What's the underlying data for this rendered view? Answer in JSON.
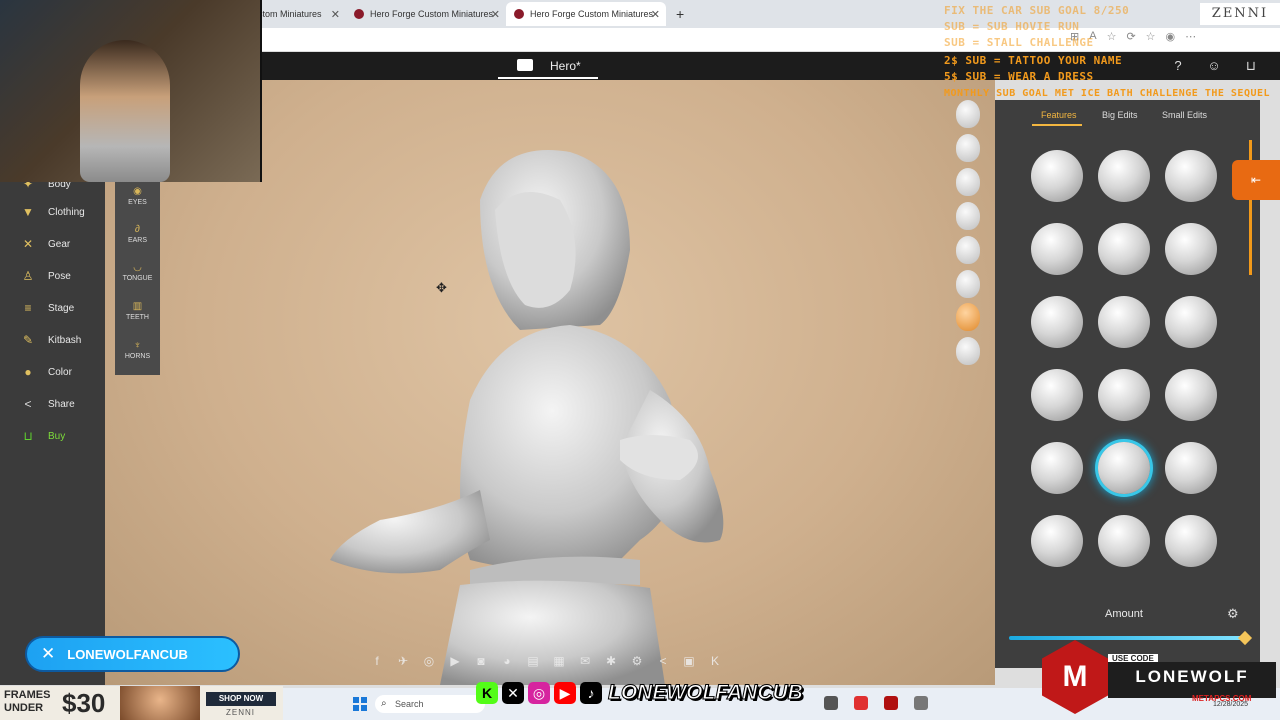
{
  "browser": {
    "tabs": [
      {
        "label": "stom Miniatures",
        "active": false
      },
      {
        "label": "Hero Forge Custom Miniatures",
        "active": false
      },
      {
        "label": "Hero Forge Custom Miniatures",
        "active": true
      }
    ],
    "new_tab": "+"
  },
  "app": {
    "title": "Hero*",
    "header_icons": [
      "help-icon",
      "account-icon",
      "cart-icon"
    ]
  },
  "left_nav": {
    "partial_top": "Body",
    "items": [
      {
        "label": "Clothing",
        "icon": "shirt-icon"
      },
      {
        "label": "Gear",
        "icon": "axes-icon"
      },
      {
        "label": "Pose",
        "icon": "figure-icon"
      },
      {
        "label": "Stage",
        "icon": "stage-icon"
      },
      {
        "label": "Kitbash",
        "icon": "kitbash-icon"
      },
      {
        "label": "Color",
        "icon": "palette-icon"
      },
      {
        "label": "Share",
        "icon": "share-icon"
      },
      {
        "label": "Buy",
        "icon": "cart-icon"
      }
    ]
  },
  "sub_nav": {
    "items": [
      {
        "label": "EYES",
        "icon": "eye-icon"
      },
      {
        "label": "EARS",
        "icon": "ear-icon"
      },
      {
        "label": "TONGUE",
        "icon": "tongue-icon"
      },
      {
        "label": "TEETH",
        "icon": "teeth-icon"
      },
      {
        "label": "HORNS",
        "icon": "horn-icon"
      }
    ]
  },
  "right_panel": {
    "tabs": [
      {
        "label": "Features",
        "active": true
      },
      {
        "label": "Big Edits",
        "active": false
      },
      {
        "label": "Small Edits",
        "active": false
      }
    ],
    "grid_rows": 6,
    "grid_cols": 3,
    "selected_index": 13,
    "amount_label": "Amount",
    "amount_value": 1.0
  },
  "overlays": {
    "goals": [
      {
        "text": "FIX THE CAR SUB GOAL 8/250",
        "dim": true
      },
      {
        "text": "SUB = SUB HOVIE RUN",
        "dim": true
      },
      {
        "text": "SUB = STALL CHALLENGE",
        "dim": true
      },
      {
        "text": "2$ SUB = TATTOO YOUR NAME",
        "dim": false
      },
      {
        "text": "5$ SUB = WEAR A DRESS",
        "dim": false
      },
      {
        "text": "MONTHLY SUB GOAL MET ICE BATH CHALLENGE THE SEQUEL",
        "dim": false
      }
    ],
    "zenni_badge": "ZENNI",
    "x_handle": "LONEWOLFANCUB",
    "social_handle": "LONEWOLFANCUB",
    "ad": {
      "line1": "FRAMES",
      "line2": "UNDER",
      "price": "$30",
      "shop": "SHOP NOW",
      "brand": "ZENNI"
    },
    "promo": {
      "code_label": "USE CODE",
      "code": "LONEWOLF",
      "site": "METAPCS.COM"
    }
  },
  "taskbar": {
    "search_placeholder": "Search",
    "date": "12/28/2025"
  },
  "colors": {
    "accent": "#f3b640",
    "selection": "#38c7e8",
    "buy": "#7ddc3a",
    "overlay_text": "#f29a1c"
  }
}
